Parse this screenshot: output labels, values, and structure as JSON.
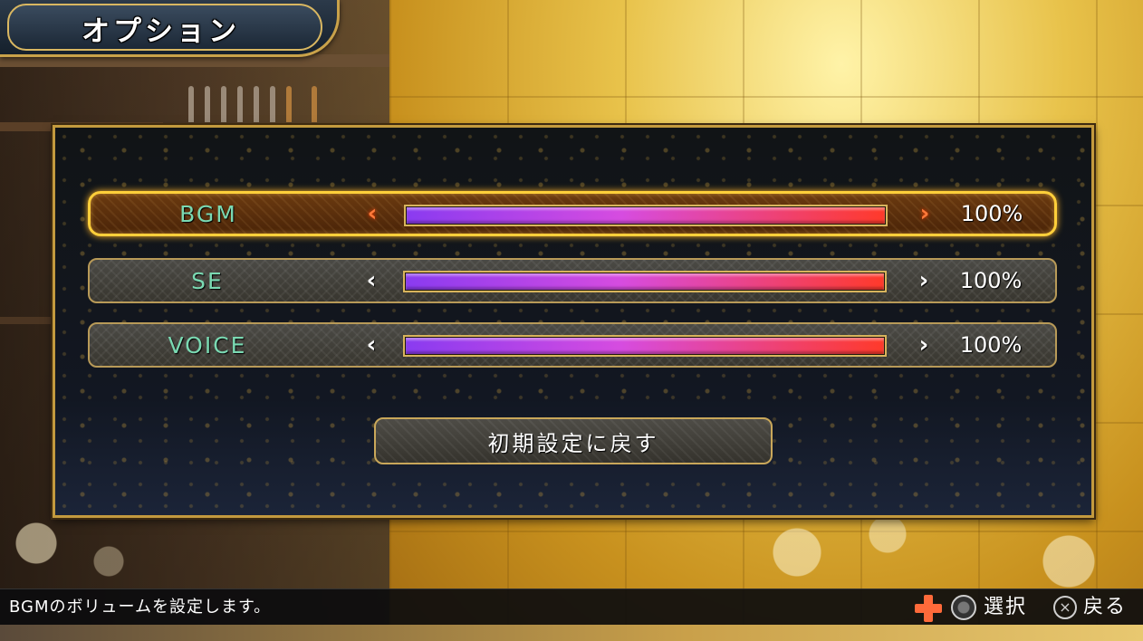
{
  "title": "オプション",
  "options": [
    {
      "label": "BGM",
      "value_text": "100%",
      "level": 1.0,
      "selected": true
    },
    {
      "label": "SE",
      "value_text": "100%",
      "level": 1.0,
      "selected": false
    },
    {
      "label": "VOICE",
      "value_text": "100%",
      "level": 1.0,
      "selected": false
    }
  ],
  "arrows": {
    "left": "‹",
    "right": "›"
  },
  "reset_button": "初期設定に戻す",
  "help": {
    "description": "BGMのボリュームを設定します。",
    "select_label": "選択",
    "cross_symbol": "×",
    "back_label": "戻る"
  }
}
